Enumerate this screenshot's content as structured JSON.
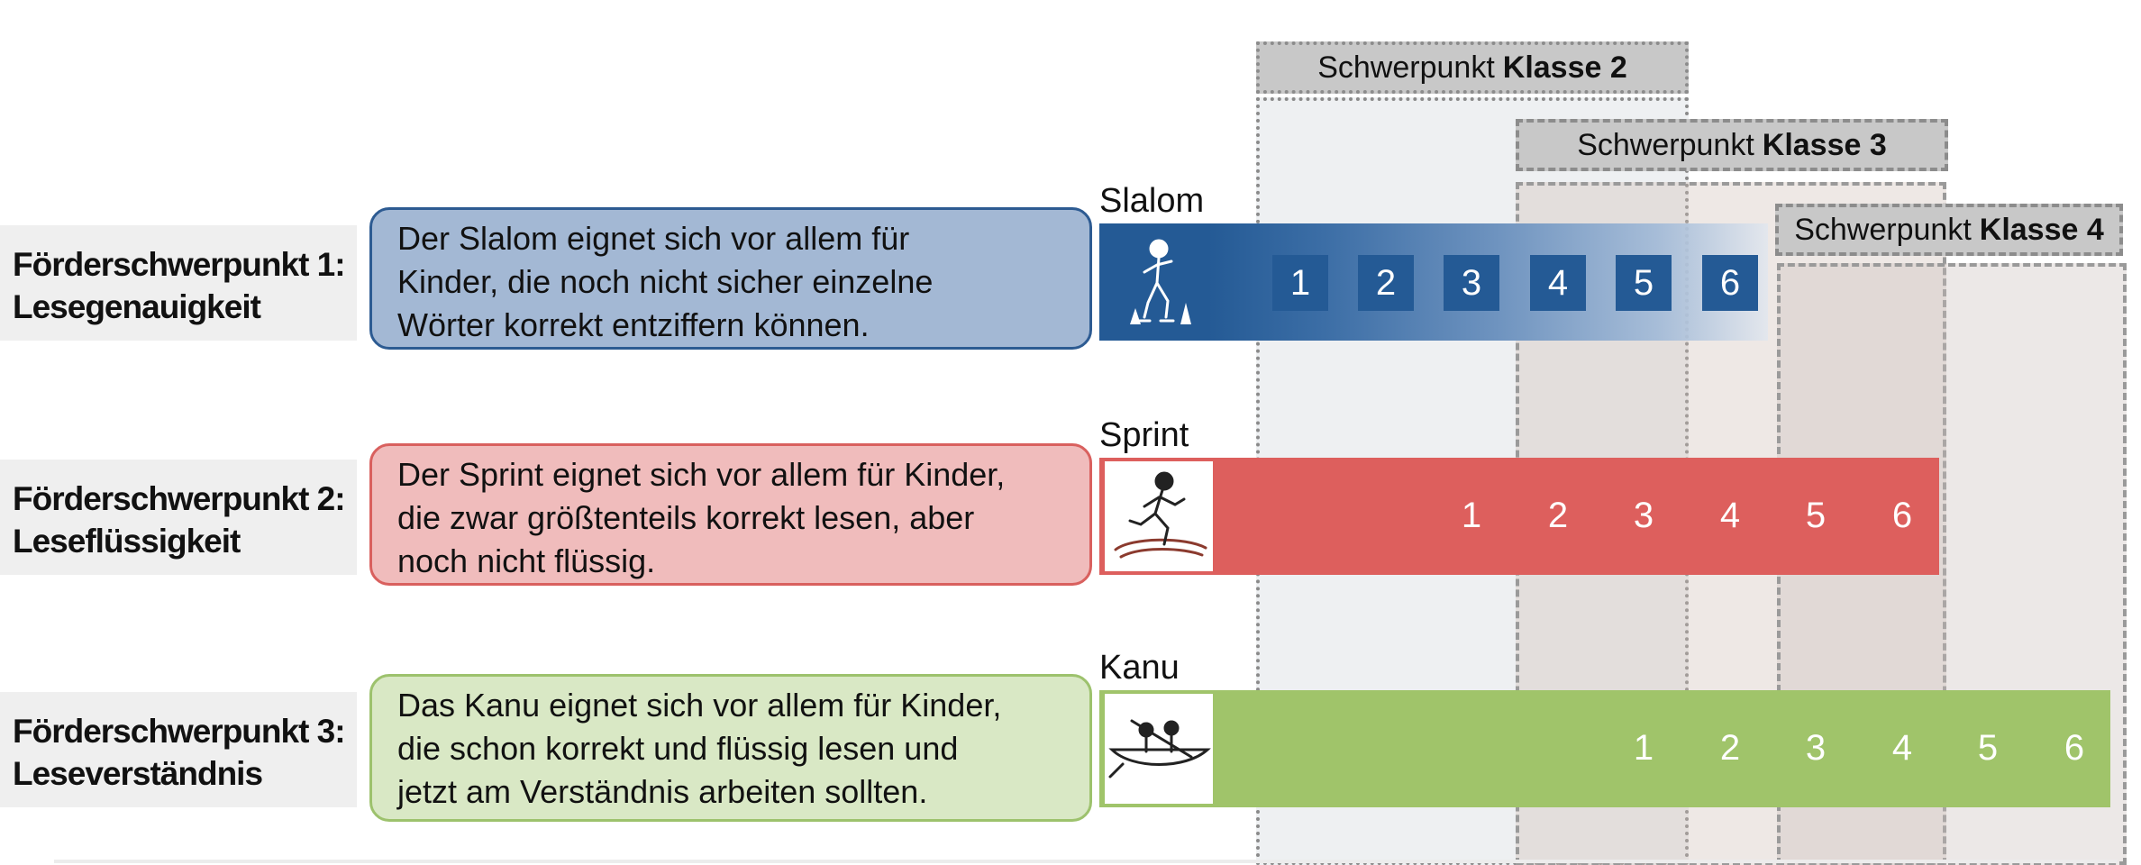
{
  "grade_focus": [
    {
      "prefix": "Schwerpunkt",
      "grade": "Klasse 2"
    },
    {
      "prefix": "Schwerpunkt",
      "grade": "Klasse 3"
    },
    {
      "prefix": "Schwerpunkt",
      "grade": "Klasse 4"
    }
  ],
  "rows": [
    {
      "label_line1": "Förderschwerpunkt 1:",
      "label_line2": "Lesegenauigkeit",
      "description": [
        "Der Slalom eignet sich vor allem für",
        "Kinder, die noch nicht sicher einzelne",
        "Wörter korrekt entziffern können."
      ],
      "strategy": "Slalom",
      "icon": "slalom-skater-icon",
      "numbers": [
        "1",
        "2",
        "3",
        "4",
        "5",
        "6"
      ],
      "color": "#245a95"
    },
    {
      "label_line1": "Förderschwerpunkt 2:",
      "label_line2": "Leseflüssigkeit",
      "description": [
        "Der Sprint eignet sich vor allem für Kinder,",
        "die zwar größtenteils korrekt lesen, aber",
        "noch nicht flüssig."
      ],
      "strategy": "Sprint",
      "icon": "sprinter-icon",
      "numbers": [
        "1",
        "2",
        "3",
        "4",
        "5",
        "6"
      ],
      "color": "#dd5f5d"
    },
    {
      "label_line1": "Förderschwerpunkt 3:",
      "label_line2": "Leseverständnis",
      "description": [
        "Das Kanu eignet sich vor allem für Kinder,",
        "die schon korrekt und flüssig lesen und",
        "jetzt am Verständnis arbeiten sollten."
      ],
      "strategy": "Kanu",
      "icon": "canoe-icon",
      "numbers": [
        "1",
        "2",
        "3",
        "4",
        "5",
        "6"
      ],
      "color": "#a0c46a"
    }
  ]
}
